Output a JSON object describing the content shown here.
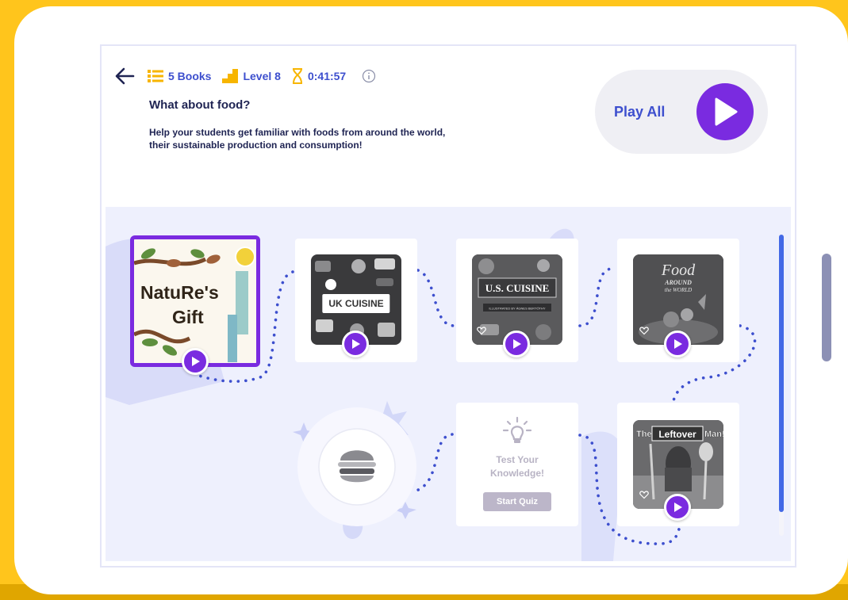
{
  "header": {
    "books_count": "5 Books",
    "level": "Level 8",
    "duration": "0:41:57"
  },
  "collection": {
    "title": "What about food?",
    "description": "Help your students get familiar with foods from around the world, their sustainable production and consumption!"
  },
  "play_all": {
    "label": "Play All"
  },
  "books": [
    {
      "title": "Nature's Gift",
      "selected": true
    },
    {
      "title": "UK CUISINE"
    },
    {
      "title": "U.S. CUISINE"
    },
    {
      "title": "Food AROUND the WORLD"
    },
    {
      "title": "The Leftover Man!"
    }
  ],
  "cover_text": {
    "natures_line1": "NatuRe's",
    "natures_line2": "Gift",
    "uk": "UK CUISINE",
    "us": "U.S. CUISINE",
    "us_sub": "ILLUSTRATED BY ÁGNES BERTÓTHY",
    "food_line1": "Food",
    "food_line2": "AROUND",
    "food_line3": "the WORLD",
    "leftover_the": "The",
    "leftover_word": "Leftover",
    "leftover_man": "Man!"
  },
  "quiz": {
    "line1": "Test Your",
    "line2": "Knowledge!",
    "button": "Start Quiz"
  },
  "colors": {
    "accent": "#7A2BE0",
    "primary_text": "#3D4FCE",
    "background": "#FFC51C",
    "path": "#3D4FCE"
  }
}
